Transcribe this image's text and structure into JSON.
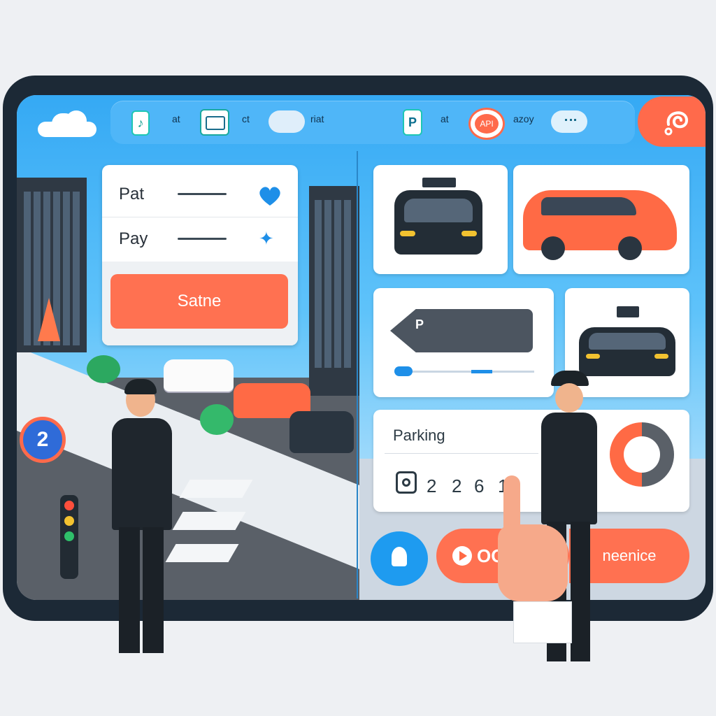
{
  "topbar": {
    "items": [
      {
        "label": "at",
        "icon": "music-icon"
      },
      {
        "label": "ct",
        "icon": "panel-icon"
      },
      {
        "label": "riat",
        "icon": "cloud-icon"
      },
      {
        "label": "at",
        "icon": "parking-icon"
      },
      {
        "label": "azoy",
        "icon": "chat-icon"
      }
    ],
    "badge_text": "API",
    "brand_icon": "swirl-icon"
  },
  "pay_card": {
    "rows": [
      {
        "label": "Pat",
        "icon": "heart-icon"
      },
      {
        "label": "Pay",
        "icon": "bird-icon"
      }
    ],
    "button_label": "Satne"
  },
  "parking_panel": {
    "title": "Parking",
    "digits": [
      "2",
      "2",
      "6",
      "1"
    ]
  },
  "bottom": {
    "action_label": "OO",
    "confirm_label": "neenice"
  },
  "street": {
    "sign_number": "2"
  },
  "colors": {
    "accent": "#ff7151",
    "sky": "#35a9f4",
    "frame": "#1c2936"
  }
}
